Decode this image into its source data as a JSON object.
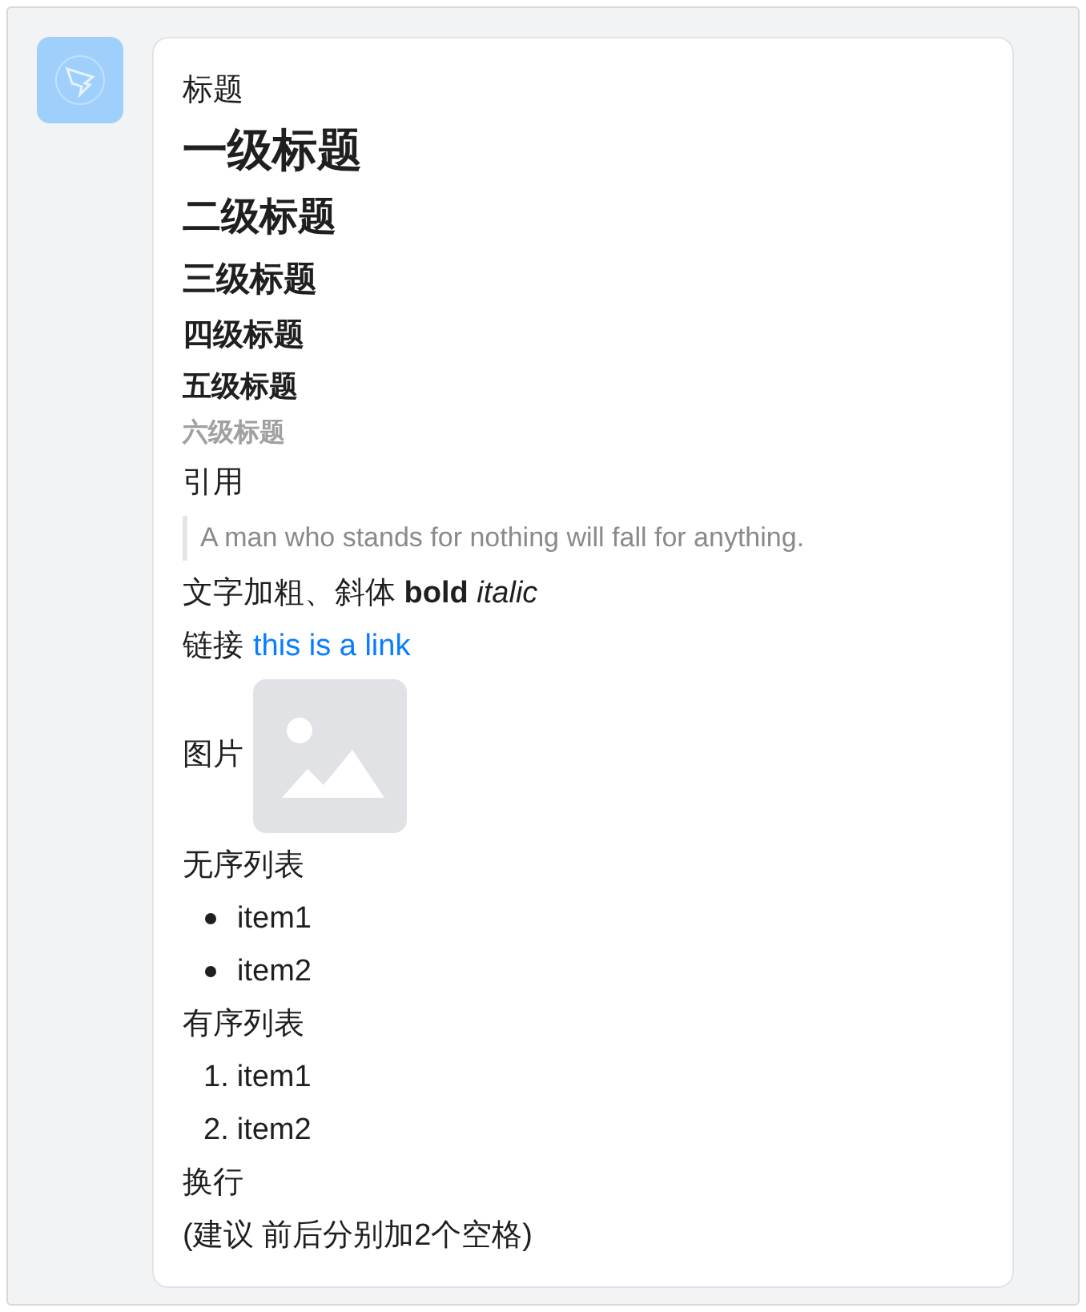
{
  "message": {
    "blocks": [
      {
        "kind": "text",
        "text": "标题"
      },
      {
        "kind": "h1",
        "text": "一级标题"
      },
      {
        "kind": "h2",
        "text": "二级标题"
      },
      {
        "kind": "h3",
        "text": "三级标题"
      },
      {
        "kind": "h4",
        "text": "四级标题"
      },
      {
        "kind": "h5",
        "text": "五级标题"
      },
      {
        "kind": "h6",
        "text": "六级标题"
      },
      {
        "kind": "text",
        "text": "引用"
      },
      {
        "kind": "quote",
        "text": "A man who stands for nothing will fall for anything."
      },
      {
        "kind": "text",
        "text": "文字加粗、斜体 **bold** *italic*"
      },
      {
        "kind": "link",
        "label": "链接",
        "link": "this is a link"
      },
      {
        "kind": "image",
        "label": "图片"
      },
      {
        "kind": "text",
        "text": "无序列表"
      },
      {
        "kind": "bullets",
        "items": [
          "item1",
          "item2"
        ]
      },
      {
        "kind": "text",
        "text": "有序列表"
      },
      {
        "kind": "numbered",
        "items": [
          {
            "marker": "1.",
            "text": "item1"
          },
          {
            "marker": "2.",
            "text": "item2"
          }
        ]
      },
      {
        "kind": "text",
        "text": "换行"
      },
      {
        "kind": "text",
        "text": "(建议 前后分别加2个空格)"
      }
    ]
  }
}
